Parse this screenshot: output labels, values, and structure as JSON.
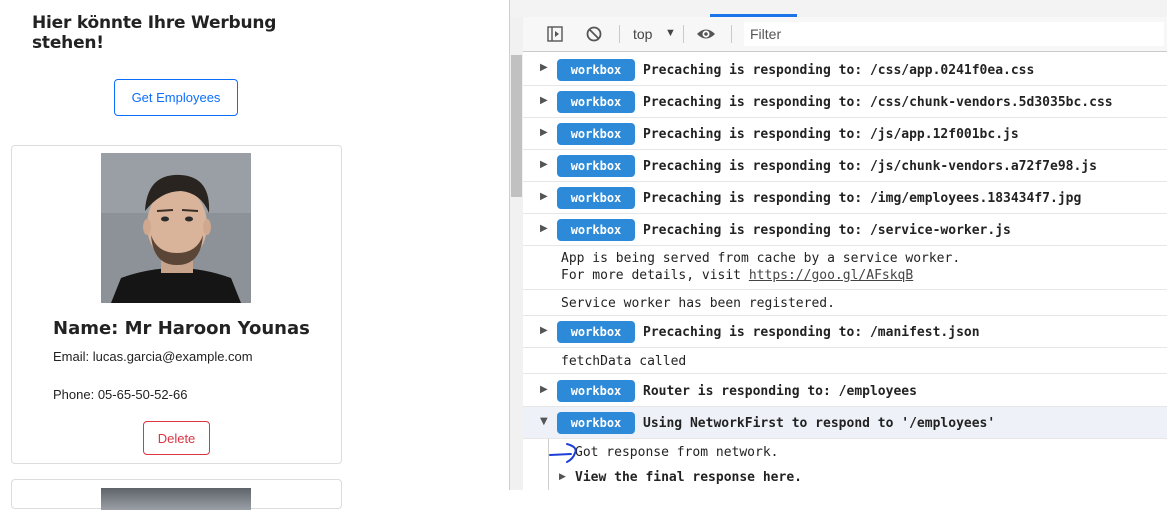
{
  "app": {
    "ad_banner": "Hier könnte Ihre Werbung stehen!",
    "get_button": "Get Employees",
    "employee": {
      "name": "Name: Mr Haroon Younas",
      "email": "Email: lucas.garcia@example.com",
      "phone": "Phone: 05-65-50-52-66",
      "delete_button": "Delete"
    }
  },
  "devtools": {
    "context": "top",
    "filter_placeholder": "Filter",
    "badge": "workbox",
    "messages": {
      "m1": "Precaching is responding to: /css/app.0241f0ea.css",
      "m2": "Precaching is responding to: /css/chunk-vendors.5d3035bc.css",
      "m3": "Precaching is responding to: /js/app.12f001bc.js",
      "m4": "Precaching is responding to: /js/chunk-vendors.a72f7e98.js",
      "m5": "Precaching is responding to: /img/employees.183434f7.jpg",
      "m6": "Precaching is responding to: /service-worker.js",
      "m7_line1": "App is being served from cache by a service worker.",
      "m7_line2_prefix": "For more details, visit ",
      "m7_link": "https://goo.gl/AFskqB",
      "m8": "Service worker has been registered.",
      "m9": "Precaching is responding to: /manifest.json",
      "m10": "fetchData called",
      "m11": "Router is responding to: /employees",
      "m12": "Using NetworkFirst to respond to '/employees'",
      "m13": "Got response from network.",
      "m14": "View the final response here."
    },
    "colors": {
      "badge": "#2d8ad8",
      "tab_accent": "#1a73e8"
    }
  }
}
